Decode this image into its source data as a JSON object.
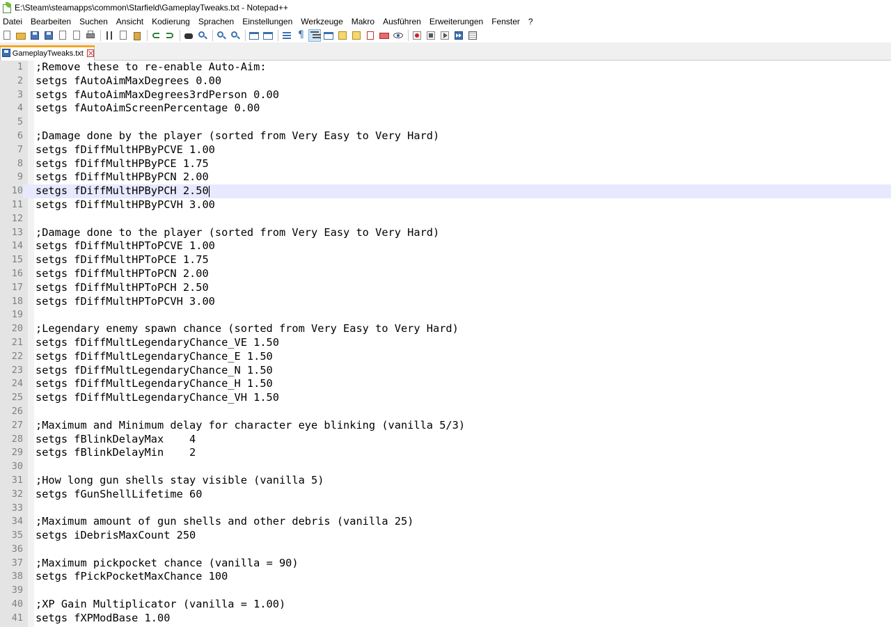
{
  "window": {
    "title": "E:\\Steam\\steamapps\\common\\Starfield\\GameplayTweaks.txt - Notepad++"
  },
  "menu": [
    "Datei",
    "Bearbeiten",
    "Suchen",
    "Ansicht",
    "Kodierung",
    "Sprachen",
    "Einstellungen",
    "Werkzeuge",
    "Makro",
    "Ausführen",
    "Erweiterungen",
    "Fenster",
    "?"
  ],
  "toolbar": {
    "icons": [
      "new-file-icon",
      "open-file-icon",
      "save-icon",
      "save-all-icon",
      "close-icon",
      "close-all-icon",
      "print-icon",
      "cut-icon",
      "copy-icon",
      "paste-icon",
      "undo-icon",
      "redo-icon",
      "find-icon",
      "replace-icon",
      "zoom-in-icon",
      "zoom-out-icon",
      "sync-vertical-icon",
      "sync-horizontal-icon",
      "word-wrap-icon",
      "show-all-characters-icon",
      "indent-guide-icon",
      "user-language-icon",
      "document-map-icon",
      "function-list-icon",
      "folder-as-workspace-icon",
      "doc-switcher-icon",
      "monitoring-icon",
      "record-macro-icon",
      "stop-macro-icon",
      "play-macro-icon",
      "run-macro-multiple-icon",
      "save-macro-icon"
    ]
  },
  "tab": {
    "label": "GameplayTweaks.txt"
  },
  "editor": {
    "current_line": 10,
    "lines": [
      ";Remove these to re-enable Auto-Aim:",
      "setgs fAutoAimMaxDegrees 0.00",
      "setgs fAutoAimMaxDegrees3rdPerson 0.00",
      "setgs fAutoAimScreenPercentage 0.00",
      "",
      ";Damage done by the player (sorted from Very Easy to Very Hard)",
      "setgs fDiffMultHPByPCVE 1.00",
      "setgs fDiffMultHPByPCE 1.75",
      "setgs fDiffMultHPByPCN 2.00",
      "setgs fDiffMultHPByPCH 2.50",
      "setgs fDiffMultHPByPCVH 3.00",
      "",
      ";Damage done to the player (sorted from Very Easy to Very Hard)",
      "setgs fDiffMultHPToPCVE 1.00",
      "setgs fDiffMultHPToPCE 1.75",
      "setgs fDiffMultHPToPCN 2.00",
      "setgs fDiffMultHPToPCH 2.50",
      "setgs fDiffMultHPToPCVH 3.00",
      "",
      ";Legendary enemy spawn chance (sorted from Very Easy to Very Hard)",
      "setgs fDiffMultLegendaryChance_VE 1.50",
      "setgs fDiffMultLegendaryChance_E 1.50",
      "setgs fDiffMultLegendaryChance_N 1.50",
      "setgs fDiffMultLegendaryChance_H 1.50",
      "setgs fDiffMultLegendaryChance_VH 1.50",
      "",
      ";Maximum and Minimum delay for character eye blinking (vanilla 5/3)",
      "setgs fBlinkDelayMax    4",
      "setgs fBlinkDelayMin    2",
      "",
      ";How long gun shells stay visible (vanilla 5)",
      "setgs fGunShellLifetime 60",
      "",
      ";Maximum amount of gun shells and other debris (vanilla 25)",
      "setgs iDebrisMaxCount 250",
      "",
      ";Maximum pickpocket chance (vanilla = 90)",
      "setgs fPickPocketMaxChance 100",
      "",
      ";XP Gain Multiplicator (vanilla = 1.00)",
      "setgs fXPModBase 1.00"
    ]
  },
  "colors": {
    "current_line_bg": "#e8e8ff",
    "gutter_bg": "#e4e4e4",
    "line_number": "#808080",
    "tab_accent": "#f5a623"
  }
}
